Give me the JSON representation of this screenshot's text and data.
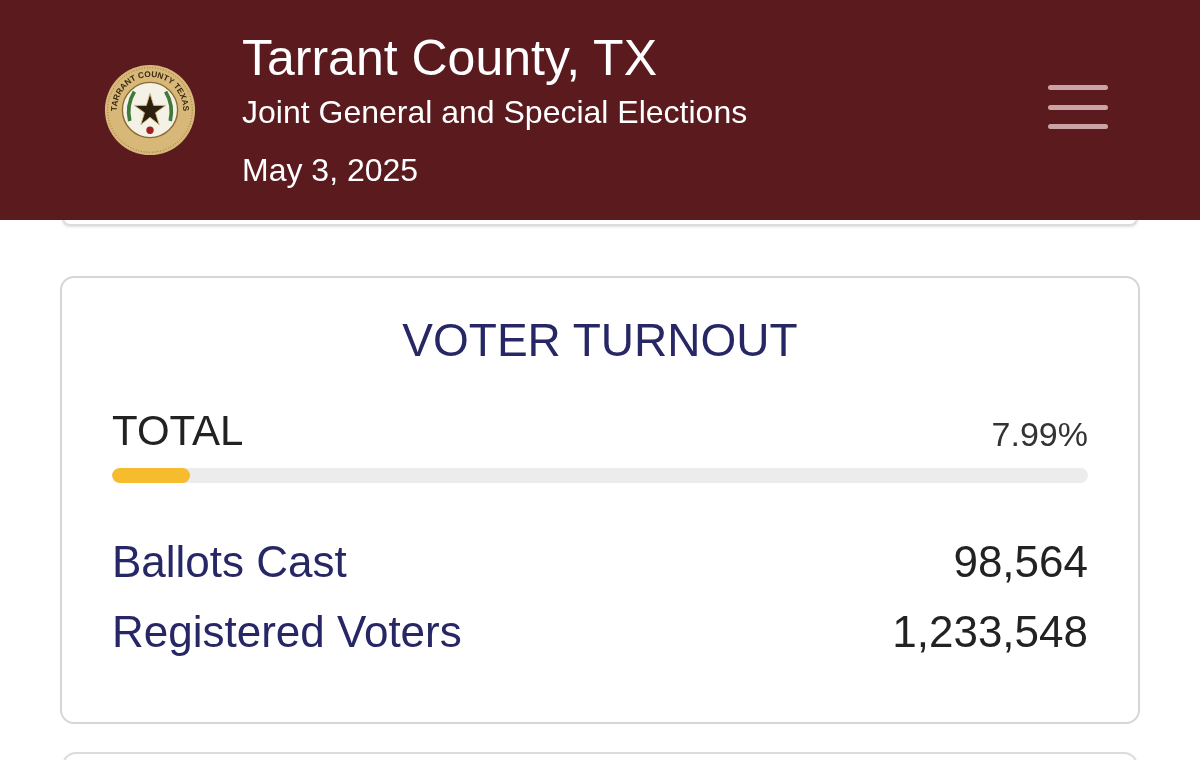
{
  "header": {
    "seal_text": "TARRANT COUNTY TEXAS",
    "title": "Tarrant County, TX",
    "subtitle": "Joint General and Special Elections",
    "date": "May 3, 2025"
  },
  "turnout": {
    "title": "VOTER TURNOUT",
    "total_label": "TOTAL",
    "total_percent": "7.99%",
    "level": 0.0799,
    "stats": [
      {
        "label": "Ballots Cast",
        "value": "98,564"
      },
      {
        "label": "Registered Voters",
        "value": "1,233,548"
      }
    ]
  }
}
